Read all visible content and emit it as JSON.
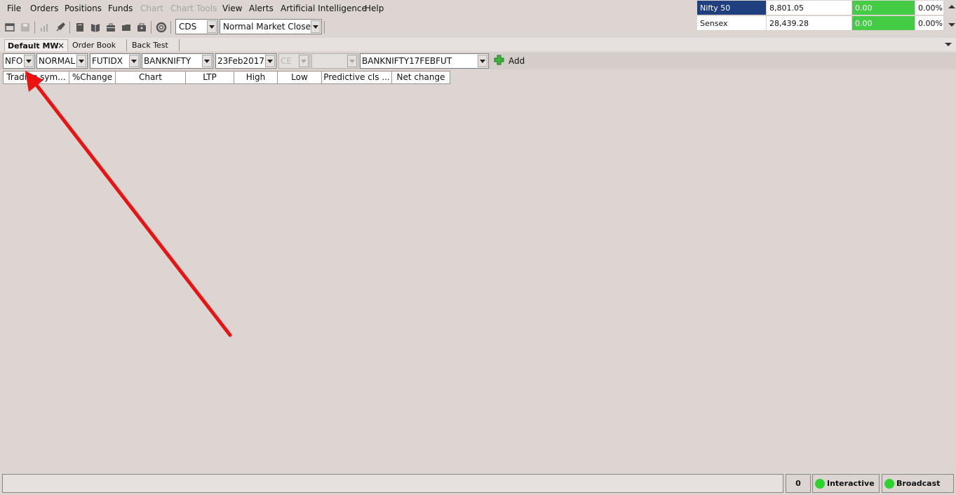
{
  "menu": {
    "items": [
      {
        "label": "File",
        "enabled": true
      },
      {
        "label": "Orders",
        "enabled": true
      },
      {
        "label": "Positions",
        "enabled": true
      },
      {
        "label": "Funds",
        "enabled": true
      },
      {
        "label": "Chart",
        "enabled": false
      },
      {
        "label": "Chart Tools",
        "enabled": false
      },
      {
        "label": "View",
        "enabled": true
      },
      {
        "label": "Alerts",
        "enabled": true
      },
      {
        "label": "Artificial Intelligence",
        "enabled": true
      },
      {
        "label": "Help",
        "enabled": true
      }
    ]
  },
  "toolbar": {
    "exchange_value": "CDS",
    "session_value": "Normal Market Close"
  },
  "ticker": {
    "rows": [
      {
        "name": "Nifty 50",
        "value": "8,801.05",
        "change": "0.00",
        "pct": "0.00%"
      },
      {
        "name": "Sensex",
        "value": "28,439.28",
        "change": "0.00",
        "pct": "0.00%"
      }
    ]
  },
  "tabs": [
    {
      "label": "Default MW",
      "active": true,
      "close": "×"
    },
    {
      "label": "Order Book",
      "active": false
    },
    {
      "label": "Back Test",
      "active": false
    }
  ],
  "picker": {
    "exchange": "NFO",
    "market": "NORMAL",
    "instrument": "FUTIDX",
    "symbol": "BANKNIFTY",
    "expiry": "23Feb2017",
    "option_type": "CE",
    "strike": "",
    "trading_symbol": "BANKNIFTY17FEBFUT",
    "add_label": "Add"
  },
  "columns": [
    "Trading sym...",
    "%Change",
    "Chart",
    "LTP",
    "High",
    "Low",
    "Predictive cls ...",
    "Net change"
  ],
  "status": {
    "message": "",
    "count": "0",
    "interactive_label": "Interactive",
    "broadcast_label": "Broadcast"
  },
  "colors": {
    "annotation_arrow": "#ee1111",
    "connected": "#2ed32e",
    "ticker_positive": "#44cc44",
    "ticker_selected": "#1f3f7f"
  }
}
